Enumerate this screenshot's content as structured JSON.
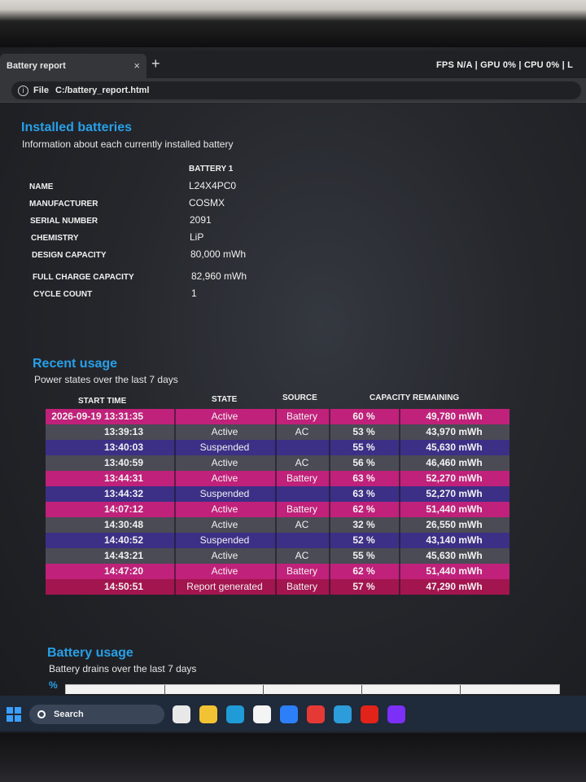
{
  "browser": {
    "tab_title": "Battery report",
    "tab_close": "×",
    "new_tab": "+",
    "overlay": "FPS N/A | GPU 0% | CPU 0% | L",
    "url_prefix": "File",
    "url": "C:/battery_report.html"
  },
  "installed": {
    "title": "Installed batteries",
    "subtitle": "Information about each currently installed battery",
    "column_header": "BATTERY 1",
    "rows": [
      {
        "label": "NAME",
        "value": "L24X4PC0"
      },
      {
        "label": "MANUFACTURER",
        "value": "COSMX"
      },
      {
        "label": "SERIAL NUMBER",
        "value": "2091"
      },
      {
        "label": "CHEMISTRY",
        "value": "LiP"
      },
      {
        "label": "DESIGN CAPACITY",
        "value": "80,000 mWh"
      },
      {
        "label": "FULL CHARGE CAPACITY",
        "value": "82,960 mWh"
      },
      {
        "label": "CYCLE COUNT",
        "value": "1"
      }
    ]
  },
  "recent": {
    "title": "Recent usage",
    "subtitle": "Power states over the last 7 days",
    "headers": {
      "start_time": "START TIME",
      "state": "STATE",
      "source": "SOURCE",
      "capacity": "CAPACITY REMAINING"
    },
    "rows": [
      {
        "time": "2026-09-19  13:31:35",
        "state": "Active",
        "source": "Battery",
        "pct": "60 %",
        "mwh": "49,780 mWh",
        "color": "#c0217a"
      },
      {
        "time": "13:39:13",
        "state": "Active",
        "source": "AC",
        "pct": "53 %",
        "mwh": "43,970 mWh",
        "color": "#4a4b55"
      },
      {
        "time": "13:40:03",
        "state": "Suspended",
        "source": "",
        "pct": "55 %",
        "mwh": "45,630 mWh",
        "color": "#3c2f86"
      },
      {
        "time": "13:40:59",
        "state": "Active",
        "source": "AC",
        "pct": "56 %",
        "mwh": "46,460 mWh",
        "color": "#4a4b55"
      },
      {
        "time": "13:44:31",
        "state": "Active",
        "source": "Battery",
        "pct": "63 %",
        "mwh": "52,270 mWh",
        "color": "#c0217a"
      },
      {
        "time": "13:44:32",
        "state": "Suspended",
        "source": "",
        "pct": "63 %",
        "mwh": "52,270 mWh",
        "color": "#3c2f86"
      },
      {
        "time": "14:07:12",
        "state": "Active",
        "source": "Battery",
        "pct": "62 %",
        "mwh": "51,440 mWh",
        "color": "#c0217a"
      },
      {
        "time": "14:30:48",
        "state": "Active",
        "source": "AC",
        "pct": "32 %",
        "mwh": "26,550 mWh",
        "color": "#4a4b55"
      },
      {
        "time": "14:40:52",
        "state": "Suspended",
        "source": "",
        "pct": "52 %",
        "mwh": "43,140 mWh",
        "color": "#3c2f86"
      },
      {
        "time": "14:43:21",
        "state": "Active",
        "source": "AC",
        "pct": "55 %",
        "mwh": "45,630 mWh",
        "color": "#4a4b55"
      },
      {
        "time": "14:47:20",
        "state": "Active",
        "source": "Battery",
        "pct": "62 %",
        "mwh": "51,440 mWh",
        "color": "#c0217a"
      },
      {
        "time": "14:50:51",
        "state": "Report generated",
        "source": "Battery",
        "pct": "57 %",
        "mwh": "47,290 mWh",
        "color": "#a3154f"
      }
    ]
  },
  "battery_usage": {
    "title": "Battery usage",
    "subtitle": "Battery drains over the last 7 days",
    "axis_label": "%"
  },
  "taskbar": {
    "search_label": "Search",
    "apps": [
      {
        "icon": "task-view-icon",
        "color": "#e8e8e8"
      },
      {
        "icon": "file-explorer-icon",
        "color": "#f1c232"
      },
      {
        "icon": "edge-icon",
        "color": "#1f9bd8"
      },
      {
        "icon": "notepad-icon",
        "color": "#f4f4f4"
      },
      {
        "icon": "camera-icon",
        "color": "#2d7ff9"
      },
      {
        "icon": "security-icon",
        "color": "#e53935"
      },
      {
        "icon": "mail-icon",
        "color": "#2d9cdb"
      },
      {
        "icon": "lenovo-icon",
        "color": "#e2231a"
      },
      {
        "icon": "vantage-icon",
        "color": "#7b2ff7"
      }
    ]
  }
}
